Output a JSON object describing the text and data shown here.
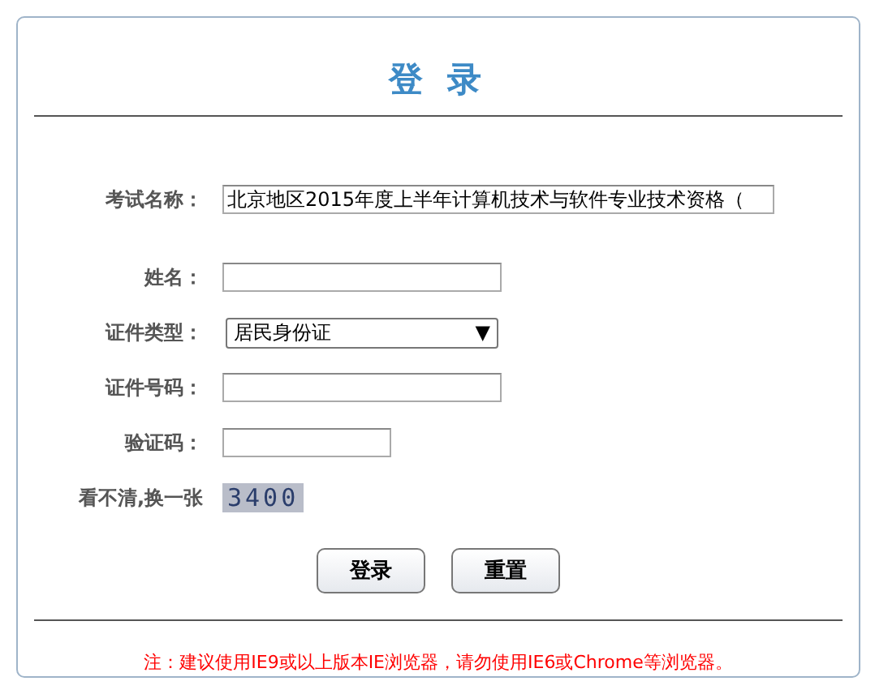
{
  "title": "登 录",
  "fields": [
    {
      "kind": "text",
      "label": "考试名称：",
      "value": "北京地区2015年度上半年计算机技术与软件专业技术资格（"
    },
    {
      "kind": "input",
      "label": "姓名："
    },
    {
      "kind": "select",
      "label": "证件类型：",
      "value": "居民身份证",
      "arrow": "▼"
    },
    {
      "kind": "input",
      "label": "证件号码："
    },
    {
      "kind": "short",
      "label": "验证码："
    }
  ],
  "captcha": {
    "label": "看不清,换一张",
    "code": "3400"
  },
  "buttons": [
    "登录",
    "重置"
  ],
  "note": "注：建议使用IE9或以上版本IE浏览器，请勿使用IE6或Chrome等浏览器。"
}
